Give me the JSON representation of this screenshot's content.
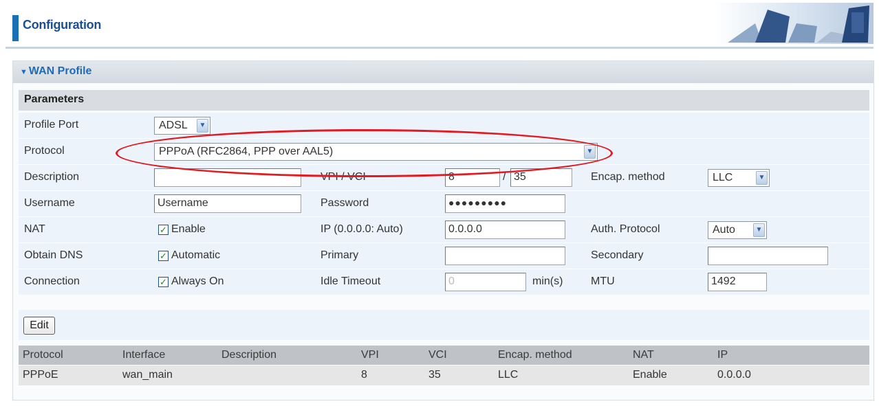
{
  "header": {
    "title": "Configuration"
  },
  "section": {
    "title": "WAN Profile",
    "collapse_icon": "triangle-down-icon",
    "parameters_label": "Parameters"
  },
  "form": {
    "profile_port": {
      "label": "Profile Port",
      "value": "ADSL"
    },
    "protocol": {
      "label": "Protocol",
      "value": "PPPoA (RFC2864, PPP over AAL5)"
    },
    "description": {
      "label": "Description",
      "value": ""
    },
    "vpi_vci": {
      "label": "VPI / VCI",
      "vpi": "8",
      "separator": "/",
      "vci": "35"
    },
    "encap_method": {
      "label": "Encap. method",
      "value": "LLC"
    },
    "username": {
      "label": "Username",
      "value": "Username"
    },
    "password": {
      "label": "Password",
      "value": "●●●●●●●●●"
    },
    "nat": {
      "label": "NAT",
      "checkbox_label": "Enable",
      "checked": true
    },
    "ip": {
      "label": "IP (0.0.0.0: Auto)",
      "value": "0.0.0.0"
    },
    "auth_protocol": {
      "label": "Auth. Protocol",
      "value": "Auto"
    },
    "obtain_dns": {
      "label": "Obtain DNS",
      "checkbox_label": "Automatic",
      "checked": true
    },
    "primary": {
      "label": "Primary",
      "value": ""
    },
    "secondary": {
      "label": "Secondary",
      "value": ""
    },
    "connection": {
      "label": "Connection",
      "checkbox_label": "Always On",
      "checked": true
    },
    "idle_timeout": {
      "label": "Idle Timeout",
      "value": "0",
      "unit": "min(s)"
    },
    "mtu": {
      "label": "MTU",
      "value": "1492"
    }
  },
  "edit_button": "Edit",
  "table": {
    "headers": [
      "Protocol",
      "Interface",
      "Description",
      "VPI",
      "VCI",
      "Encap. method",
      "NAT",
      "IP"
    ],
    "rows": [
      [
        "PPPoE",
        "wan_main",
        "",
        "8",
        "35",
        "LLC",
        "Enable",
        "0.0.0.0"
      ]
    ]
  },
  "colors": {
    "accent": "#1b6fb5",
    "title": "#1c4f8f",
    "annotation": "#e01b24",
    "row_bg": "#edf3fa"
  }
}
